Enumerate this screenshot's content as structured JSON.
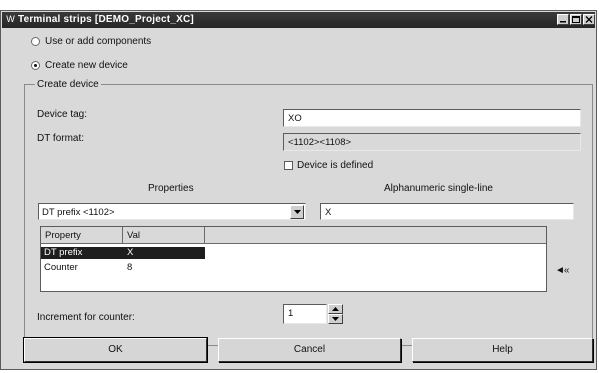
{
  "window": {
    "title": "Terminal strips [DEMO_Project_XC]",
    "title_icon": "W"
  },
  "options": {
    "use_existing": "Use or add components",
    "create_new": "Create new device",
    "selected": "create_new"
  },
  "create_device": {
    "group_title": "Create device",
    "device_tag_label": "Device tag:",
    "device_tag_value": "XO",
    "dt_format_label": "DT format:",
    "dt_format_value": "<1102><1108>",
    "device_defined_label": "Device is defined",
    "device_defined_checked": false
  },
  "properties": {
    "header": "Properties",
    "alphanumeric_header": "Alphanumeric single-line",
    "selected_property": "DT prefix <1102>",
    "alphanumeric_value": "X",
    "columns": [
      "Property",
      "Val"
    ],
    "rows": [
      {
        "property": "DT prefix",
        "value": "X",
        "selected": true
      },
      {
        "property": "Counter",
        "value": "8",
        "selected": false
      }
    ],
    "side_arrow": "◄«"
  },
  "increment": {
    "label": "Increment for counter:",
    "value": "1"
  },
  "buttons": {
    "ok": "OK",
    "cancel": "Cancel",
    "help": "Help"
  }
}
